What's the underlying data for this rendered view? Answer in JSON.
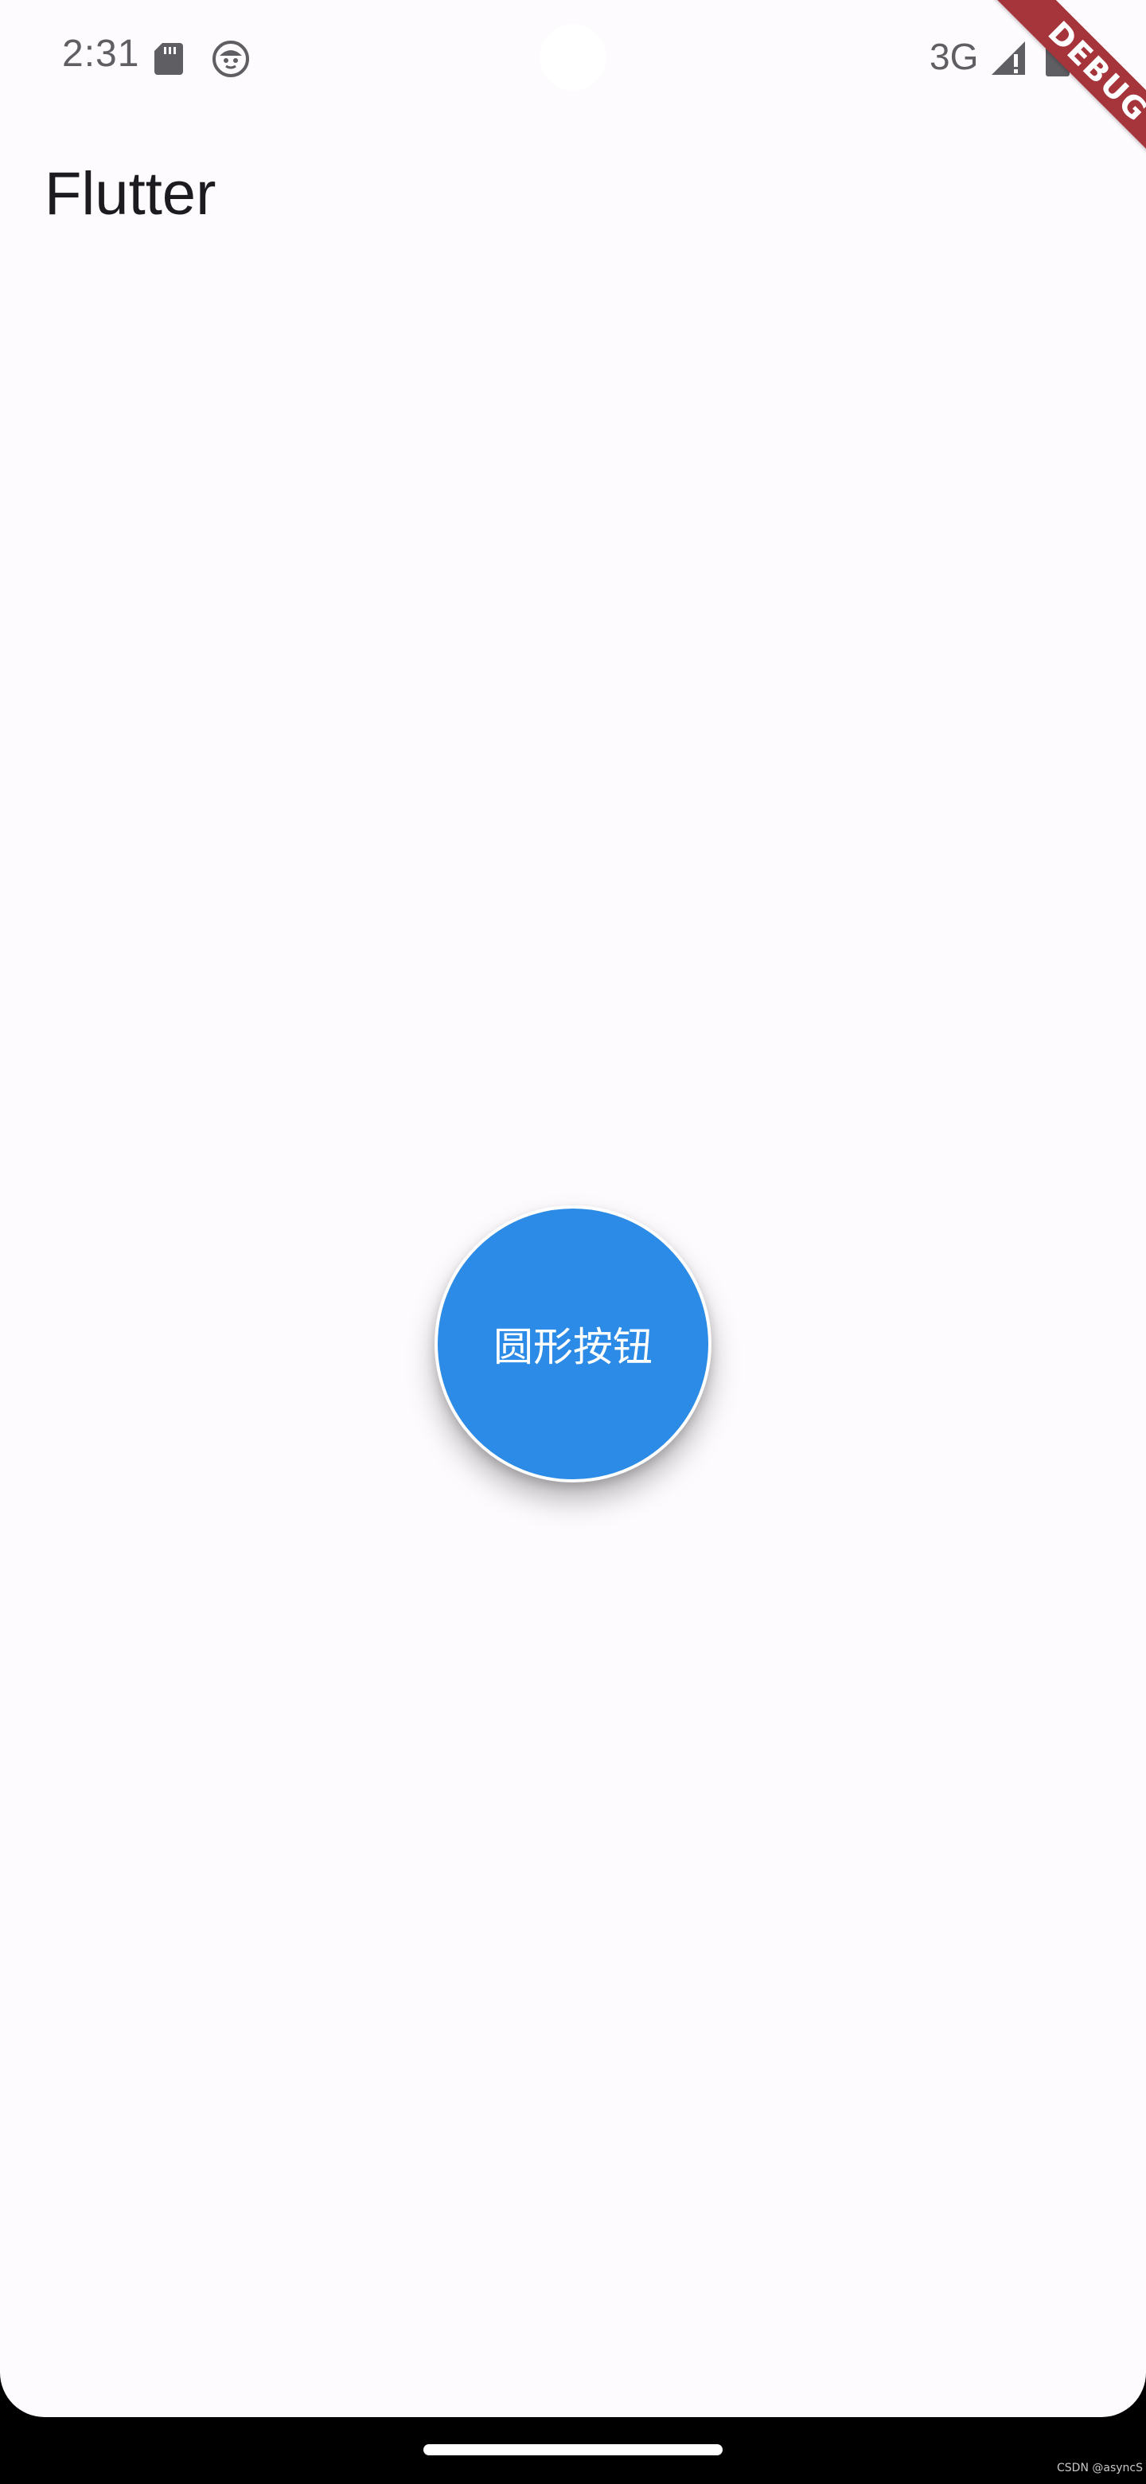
{
  "status_bar": {
    "time": "2:31",
    "network": "3G",
    "icons": [
      "sd-card-icon",
      "face-notification-icon",
      "signal-icon",
      "battery-icon"
    ],
    "text_color": "#5f5f63"
  },
  "debug_banner": {
    "label": "DEBUG",
    "color": "#a6343b"
  },
  "app_bar": {
    "title": "Flutter"
  },
  "main": {
    "circle_button": {
      "label": "圆形按钮",
      "color": "#2b8be6"
    }
  },
  "watermark": {
    "text": "CSDN @asyncS"
  },
  "colors": {
    "background": "#fefbfe",
    "nav_bar": "#000000"
  }
}
